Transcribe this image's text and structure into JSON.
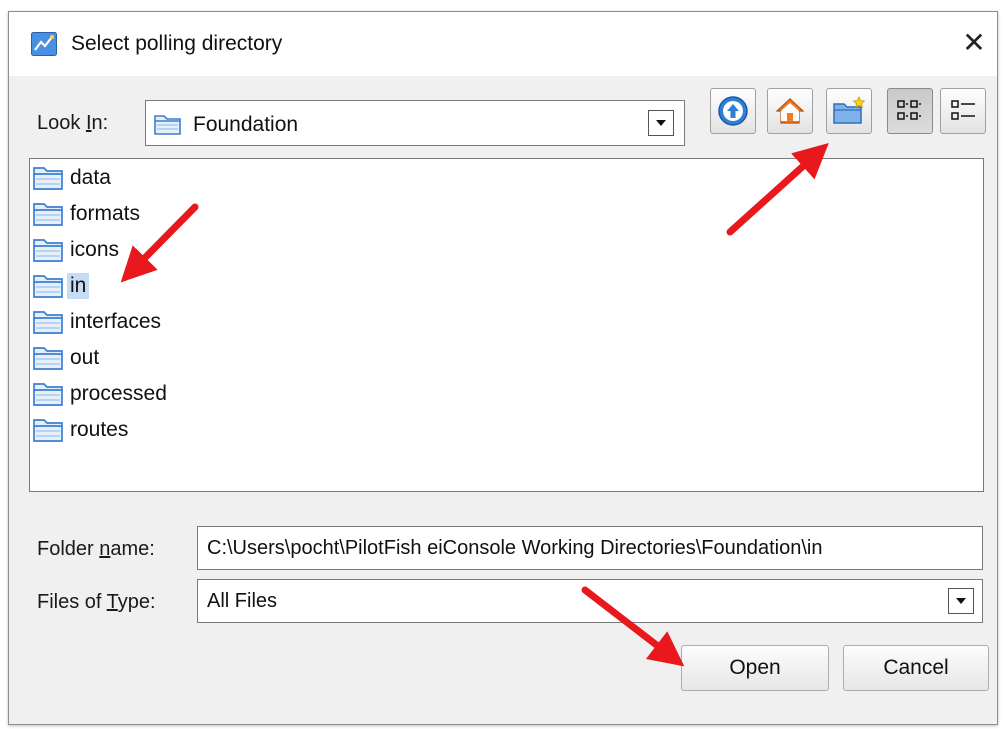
{
  "window": {
    "title": "Select polling directory",
    "close_glyph": "✕"
  },
  "look_in": {
    "label_pre": "Look ",
    "label_mnemonic": "I",
    "label_post": "n:",
    "value": "Foundation"
  },
  "toolbar": {
    "icons": [
      "up-one-level-icon",
      "home-icon",
      "new-folder-icon",
      "list-view-icon",
      "details-view-icon"
    ],
    "list_view_selected": true
  },
  "files": [
    {
      "name": "data",
      "selected": false
    },
    {
      "name": "formats",
      "selected": false
    },
    {
      "name": "icons",
      "selected": false
    },
    {
      "name": "in",
      "selected": true
    },
    {
      "name": "interfaces",
      "selected": false
    },
    {
      "name": "out",
      "selected": false
    },
    {
      "name": "processed",
      "selected": false
    },
    {
      "name": "routes",
      "selected": false
    }
  ],
  "folder_name": {
    "label_pre": "Folder ",
    "label_mnemonic": "n",
    "label_post": "ame:",
    "value": "C:\\Users\\pocht\\PilotFish eiConsole Working Directories\\Foundation\\in"
  },
  "files_of_type": {
    "label_pre": "Files of ",
    "label_mnemonic": "T",
    "label_post": "ype:",
    "value": "All Files"
  },
  "buttons": {
    "open": "Open",
    "cancel": "Cancel"
  },
  "colors": {
    "selection": "#c6dcf5",
    "annotation_arrow": "#e8181c",
    "folder_blue": "#3b7fd1"
  }
}
